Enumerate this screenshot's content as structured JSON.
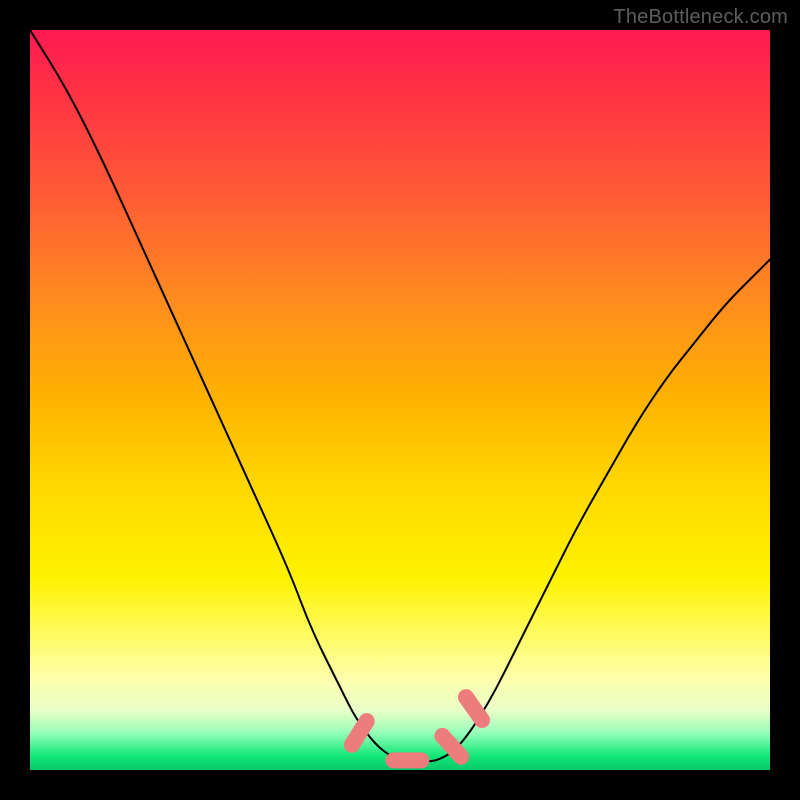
{
  "watermark": "TheBottleneck.com",
  "chart_data": {
    "type": "line",
    "title": "",
    "xlabel": "",
    "ylabel": "",
    "xlim": [
      0,
      100
    ],
    "ylim": [
      0,
      100
    ],
    "series": [
      {
        "name": "bottleneck-curve",
        "x": [
          0,
          5,
          10,
          15,
          20,
          25,
          30,
          35,
          38,
          42,
          44,
          47,
          50,
          53,
          55,
          58,
          62,
          66,
          70,
          74,
          78,
          82,
          86,
          90,
          94,
          98,
          100
        ],
        "values": [
          100,
          92,
          82,
          71,
          60,
          49,
          38,
          27,
          19,
          11,
          7,
          3,
          1.2,
          1.2,
          1.2,
          3,
          9,
          17,
          25,
          33,
          40,
          47,
          53,
          58,
          63,
          67,
          69
        ]
      }
    ],
    "markers": [
      {
        "name": "left-pill",
        "x_center": 44.5,
        "y_center": 5.0,
        "angle_deg": -58
      },
      {
        "name": "flat-pill",
        "x_center": 51.0,
        "y_center": 1.3,
        "angle_deg": 0
      },
      {
        "name": "right-pill",
        "x_center": 57.0,
        "y_center": 3.2,
        "angle_deg": 48
      },
      {
        "name": "top-right-pill",
        "x_center": 60.0,
        "y_center": 8.3,
        "angle_deg": 55
      }
    ],
    "gradient_stops": [
      {
        "pos": 0.0,
        "color": "#ff1a52"
      },
      {
        "pos": 0.5,
        "color": "#ffd900"
      },
      {
        "pos": 0.88,
        "color": "#fdffb0"
      },
      {
        "pos": 1.0,
        "color": "#04c968"
      }
    ]
  }
}
